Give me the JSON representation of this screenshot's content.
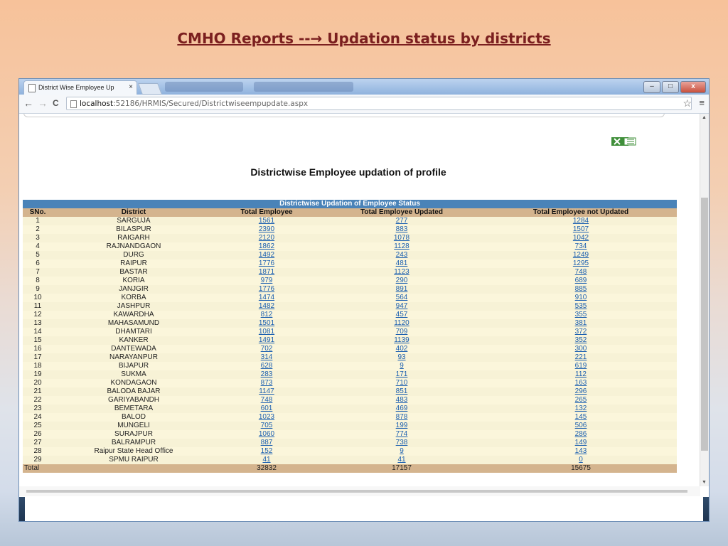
{
  "slide": {
    "title": "CMHO Reports --→ Updation status by districts"
  },
  "browser": {
    "tab_title": "District Wise Employee Up",
    "tab_close": "×",
    "url_host": "localhost",
    "url_path": ":52186/HRMIS/Secured/Districtwiseempupdate.aspx",
    "back": "←",
    "forward": "→",
    "reload": "C",
    "star": "☆",
    "menu": "≡",
    "minimize": "–",
    "maximize": "□",
    "close": "x"
  },
  "page": {
    "heading": "Districtwise Employee updation of profile",
    "excel_icon": "excel-export-icon"
  },
  "table": {
    "caption": "Districtwise Updation of Employee Status",
    "headers": [
      "SNo.",
      "District",
      "Total Employee",
      "Total Employee Updated",
      "Total Employee not Updated"
    ],
    "rows": [
      [
        "1",
        "SARGUJA",
        "1561",
        "277",
        "1284"
      ],
      [
        "2",
        "BILASPUR",
        "2390",
        "883",
        "1507"
      ],
      [
        "3",
        "RAIGARH",
        "2120",
        "1078",
        "1042"
      ],
      [
        "4",
        "RAJNANDGAON",
        "1862",
        "1128",
        "734"
      ],
      [
        "5",
        "DURG",
        "1492",
        "243",
        "1249"
      ],
      [
        "6",
        "RAIPUR",
        "1776",
        "481",
        "1295"
      ],
      [
        "7",
        "BASTAR",
        "1871",
        "1123",
        "748"
      ],
      [
        "8",
        "KORIA",
        "979",
        "290",
        "689"
      ],
      [
        "9",
        "JANJGIR",
        "1776",
        "891",
        "885"
      ],
      [
        "10",
        "KORBA",
        "1474",
        "564",
        "910"
      ],
      [
        "11",
        "JASHPUR",
        "1482",
        "947",
        "535"
      ],
      [
        "12",
        "KAWARDHA",
        "812",
        "457",
        "355"
      ],
      [
        "13",
        "MAHASAMUND",
        "1501",
        "1120",
        "381"
      ],
      [
        "14",
        "DHAMTARI",
        "1081",
        "709",
        "372"
      ],
      [
        "15",
        "KANKER",
        "1491",
        "1139",
        "352"
      ],
      [
        "16",
        "DANTEWADA",
        "702",
        "402",
        "300"
      ],
      [
        "17",
        "NARAYANPUR",
        "314",
        "93",
        "221"
      ],
      [
        "18",
        "BIJAPUR",
        "628",
        "9",
        "619"
      ],
      [
        "19",
        "SUKMA",
        "283",
        "171",
        "112"
      ],
      [
        "20",
        "KONDAGAON",
        "873",
        "710",
        "163"
      ],
      [
        "21",
        "BALODA BAJAR",
        "1147",
        "851",
        "296"
      ],
      [
        "22",
        "GARIYABANDH",
        "748",
        "483",
        "265"
      ],
      [
        "23",
        "BEMETARA",
        "601",
        "469",
        "132"
      ],
      [
        "24",
        "BALOD",
        "1023",
        "878",
        "145"
      ],
      [
        "25",
        "MUNGELI",
        "705",
        "199",
        "506"
      ],
      [
        "26",
        "SURAJPUR",
        "1060",
        "774",
        "286"
      ],
      [
        "27",
        "BALRAMPUR",
        "887",
        "738",
        "149"
      ],
      [
        "28",
        "Raipur State Head Office",
        "152",
        "9",
        "143"
      ],
      [
        "29",
        "SPMU RAIPUR",
        "41",
        "41",
        "0"
      ]
    ],
    "total": {
      "label": "Total",
      "total_employee": "32832",
      "updated": "17157",
      "not_updated": "15675"
    }
  }
}
